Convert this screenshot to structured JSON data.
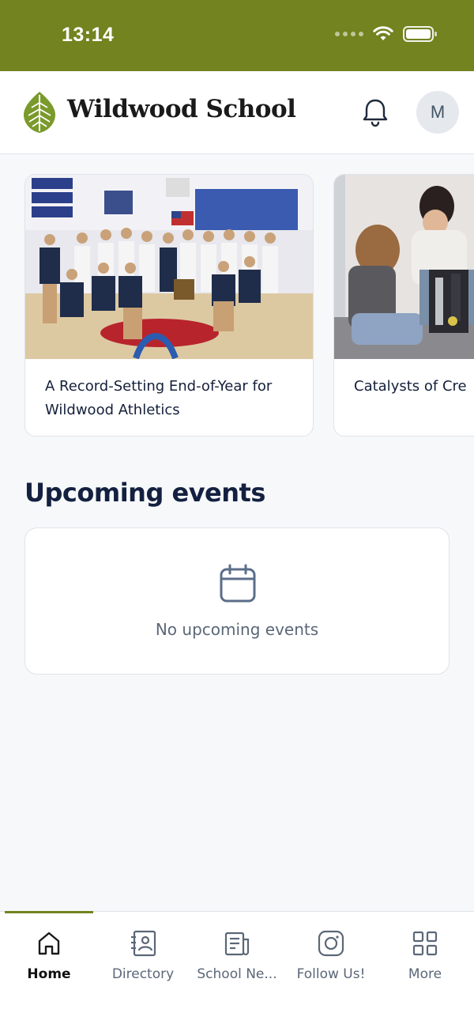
{
  "status_bar": {
    "time": "13:14",
    "icons": [
      "cellular-dots-icon",
      "wifi-icon",
      "battery-icon"
    ]
  },
  "header": {
    "school_name": "Wildwood School",
    "logo_icon": "leaf-logo-icon",
    "notification_icon": "bell-icon",
    "avatar_initial": "M"
  },
  "news_carousel": {
    "items": [
      {
        "title": "A Record-Setting End-of-Year for Wildwood Athletics",
        "image": "volleyball-team-photo"
      },
      {
        "title": "Catalysts of Cre",
        "image": "robotics-students-photo"
      }
    ]
  },
  "events": {
    "section_title": "Upcoming events",
    "empty_icon": "calendar-icon",
    "empty_text": "No upcoming events"
  },
  "tab_bar": {
    "active_index": 0,
    "tabs": [
      {
        "label": "Home",
        "icon": "home-icon"
      },
      {
        "label": "Directory",
        "icon": "directory-icon"
      },
      {
        "label": "School Ne...",
        "icon": "newspaper-icon"
      },
      {
        "label": "Follow Us!",
        "icon": "instagram-icon"
      },
      {
        "label": "More",
        "icon": "grid-icon"
      }
    ]
  },
  "colors": {
    "brand_green": "#72831f",
    "title_navy": "#142040",
    "muted_text": "#5b6778"
  }
}
